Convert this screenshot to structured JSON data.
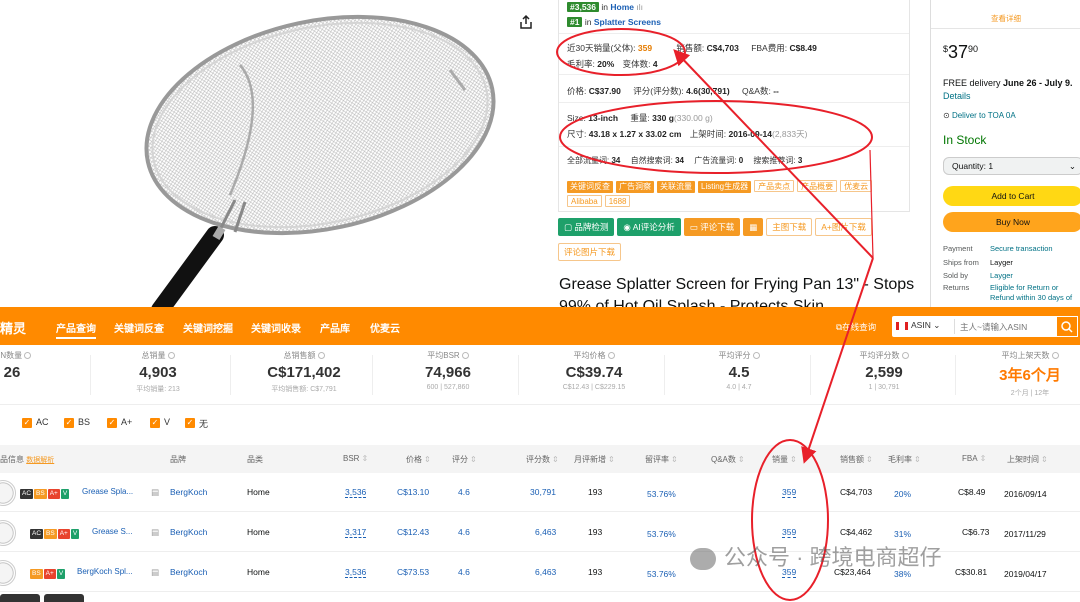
{
  "info_panel": {
    "rank1_num": "#3,536",
    "rank1_in": "in",
    "rank1_cat": "Home",
    "rank2_num": "#1",
    "rank2_in": "in",
    "rank2_cat": "Splatter Screens",
    "sales30_label": "近30天销量(父体):",
    "sales30_value": "359",
    "revenue_label": "销售额:",
    "revenue_value": "C$4,703",
    "fba_label": "FBA费用:",
    "fba_value": "C$8.49",
    "margin_label": "毛利率:",
    "margin_value": "20%",
    "variants_label": "变体数:",
    "variants_value": "4",
    "price_label": "价格:",
    "price_value": "C$37.90",
    "rating_label": "评分(评分数):",
    "rating_value": "4.6(30,791)",
    "qa_label": "Q&A数:",
    "qa_value": "--",
    "size_label": "Size:",
    "size_value": "13-inch",
    "weight_label": "重量:",
    "weight_value": "330 g",
    "weight_alt": "(330.00 g)",
    "dim_label": "尺寸:",
    "dim_value": "43.18 x 1.27 x 33.02 cm",
    "listed_label": "上架时间:",
    "listed_value": "2016-09-14",
    "listed_days": "(2,833天)",
    "kw_all_label": "全部流量词:",
    "kw_all_value": "34",
    "kw_organic_label": "自然搜索词:",
    "kw_organic_value": "34",
    "kw_ad_label": "广告流量词:",
    "kw_ad_value": "0",
    "kw_suggest_label": "搜索推荐词:",
    "kw_suggest_value": "3",
    "tags_solid": [
      "关键词反查",
      "广告洞察",
      "关联流量",
      "Listing生成器"
    ],
    "tags_outline": [
      "产品卖点",
      "产品概要",
      "优麦云",
      "Alibaba",
      "1688"
    ]
  },
  "actions": {
    "btn1": "品牌检测",
    "btn2": "AI评论分析",
    "btn3": "评论下载",
    "btn5": "主图下载",
    "btn6": "A+图片下载",
    "btn7": "评论图片下载"
  },
  "product_title": "Grease Splatter Screen for Frying Pan 13\" - Stops 99% of Hot Oil Splash - Protects Skin",
  "buybox": {
    "top_link": "查看详细",
    "price_dollar": "$",
    "price_whole": "37",
    "price_frac": "90",
    "delivery_prefix": "FREE delivery",
    "delivery_dates": "June 26 - July 9.",
    "details_link": "Details",
    "deliver_to": "Deliver to TOA 0A",
    "in_stock": "In Stock",
    "quantity": "Quantity: 1",
    "add_to_cart": "Add to Cart",
    "buy_now": "Buy Now",
    "payment_k": "Payment",
    "payment_v": "Secure transaction",
    "ships_k": "Ships from",
    "ships_v": "Layger",
    "sold_k": "Sold by",
    "sold_v": "Layger",
    "returns_k": "Returns",
    "returns_v1": "Eligible for Return or",
    "returns_v2": "Refund within 30 days of"
  },
  "nav": {
    "logo": "精灵",
    "items": [
      "产品查询",
      "关键词反查",
      "关键词挖掘",
      "关键词收录",
      "产品库",
      "优麦云"
    ],
    "online": "在线查询",
    "search_select": "ASIN",
    "search_placeholder": "主人~请输入ASIN"
  },
  "stats": [
    {
      "label": "SIN数量",
      "value": "26",
      "sub": ""
    },
    {
      "label": "总销量",
      "value": "4,903",
      "sub": "平均销量: 213"
    },
    {
      "label": "总销售额",
      "value": "C$171,402",
      "sub": "平均销售额: C$7,791"
    },
    {
      "label": "平均BSR",
      "value": "74,966",
      "sub": "600 | 527,860"
    },
    {
      "label": "平均价格",
      "value": "C$39.74",
      "sub": "C$12.43 | C$229.15"
    },
    {
      "label": "平均评分",
      "value": "4.5",
      "sub": "4.0 | 4.7"
    },
    {
      "label": "平均评分数",
      "value": "2,599",
      "sub": "1 | 30,791"
    },
    {
      "label": "平均上架天数",
      "value": "3年6个月",
      "sub": "2个月 | 12年"
    }
  ],
  "filters": [
    "AC",
    "BS",
    "A+",
    "V",
    "无"
  ],
  "table": {
    "headers": [
      "品信息",
      "数据解析",
      "品牌",
      "品类",
      "BSR",
      "价格",
      "评分",
      "评分数",
      "月评新增",
      "留评率",
      "Q&A数",
      "销量",
      "销售额",
      "毛利率",
      "FBA",
      "上架时间"
    ],
    "rows": [
      {
        "name": "Grease Spla...",
        "brand": "BergKoch",
        "cat": "Home",
        "bsr": "3,536",
        "price": "C$13.10",
        "rating": "4.6",
        "reviews": "30,791",
        "monthly": "193",
        "rate": "53.76%",
        "qa": "",
        "sales": "359",
        "revenue": "C$4,703",
        "margin": "20%",
        "fba": "C$8.49",
        "date": "2016/09/14"
      },
      {
        "name": "Grease S...",
        "brand": "BergKoch",
        "cat": "Home",
        "bsr": "3,317",
        "price": "C$12.43",
        "rating": "4.6",
        "reviews": "6,463",
        "monthly": "193",
        "rate": "53.76%",
        "qa": "",
        "sales": "359",
        "revenue": "C$4,462",
        "margin": "31%",
        "fba": "C$6.73",
        "date": "2017/11/29"
      },
      {
        "name": "BergKoch Spl...",
        "brand": "BergKoch",
        "cat": "Home",
        "bsr": "3,536",
        "price": "C$73.53",
        "rating": "4.6",
        "reviews": "6,463",
        "monthly": "193",
        "rate": "53.76%",
        "qa": "",
        "sales": "359",
        "revenue": "C$23,464",
        "margin": "38%",
        "fba": "C$30.81",
        "date": "2019/04/17"
      }
    ]
  },
  "watermark": "公众号 · 跨境电商超仔",
  "colors": {
    "accent": "#ff8a00",
    "annotation": "#e8202a",
    "link": "#1a5fb4",
    "green": "#1ea06a"
  }
}
